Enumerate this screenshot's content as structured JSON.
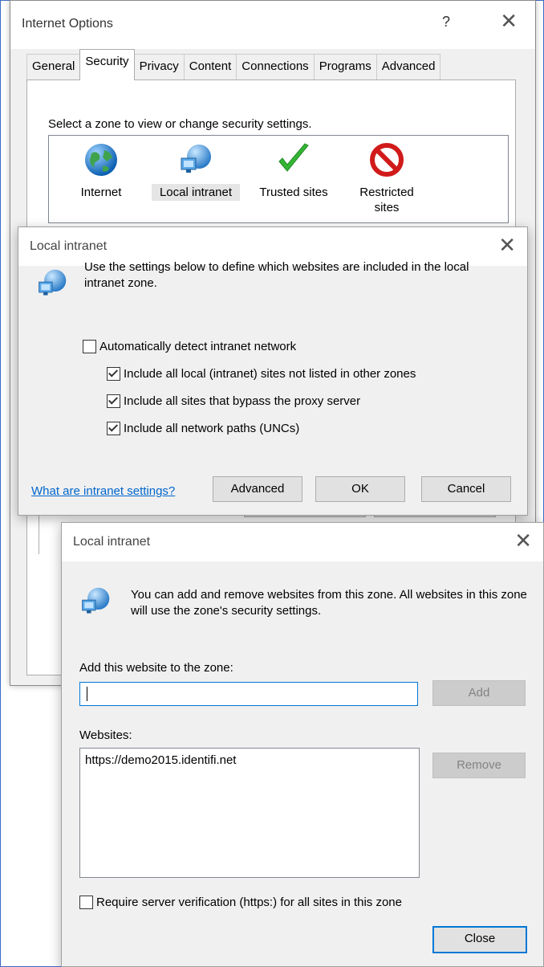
{
  "internet_options": {
    "title": "Internet Options",
    "help": "?",
    "close": "✕",
    "tabs": [
      "General",
      "Security",
      "Privacy",
      "Content",
      "Connections",
      "Programs",
      "Advanced"
    ],
    "active_tab": "Security",
    "zone_prompt": "Select a zone to view or change security settings.",
    "zones": [
      {
        "icon": "globe-icon",
        "label": "Internet"
      },
      {
        "icon": "local-intranet-icon",
        "label": "Local intranet"
      },
      {
        "icon": "checkmark-icon",
        "label": "Trusted sites"
      },
      {
        "icon": "no-entry-icon",
        "label": "Restricted sites"
      }
    ],
    "selected_zone": "Local intranet"
  },
  "intranet_dialog": {
    "title": "Local intranet",
    "close": "✕",
    "description": "Use the settings below to define which websites are included in the local intranet zone.",
    "options": [
      {
        "label": "Automatically detect intranet network",
        "checked": false
      },
      {
        "label": "Include all local (intranet) sites not listed in other zones",
        "checked": true
      },
      {
        "label": "Include all sites that bypass the proxy server",
        "checked": true
      },
      {
        "label": "Include all network paths (UNCs)",
        "checked": true
      }
    ],
    "help_link": "What are intranet settings?",
    "buttons": {
      "advanced": "Advanced",
      "ok": "OK",
      "cancel": "Cancel"
    }
  },
  "sites_dialog": {
    "title": "Local intranet",
    "close": "✕",
    "description": "You can add and remove websites from this zone. All websites in this zone will use the zone's security settings.",
    "add_label": "Add this website to the zone:",
    "add_value": "",
    "add_button": "Add",
    "websites_label": "Websites:",
    "websites": [
      "https://demo2015.identifi.net"
    ],
    "remove_button": "Remove",
    "require_https": {
      "label": "Require server verification (https:) for all sites in this zone",
      "checked": false
    },
    "close_button": "Close"
  }
}
